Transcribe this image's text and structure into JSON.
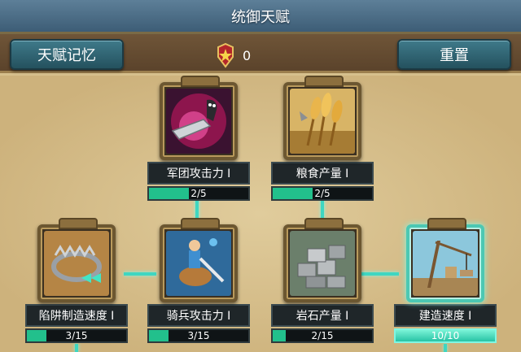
{
  "window": {
    "title": "统御天赋"
  },
  "header": {
    "memory_button": "天赋记忆",
    "reset_button": "重置",
    "points": "0"
  },
  "talents": [
    {
      "name": "军团攻击力 I",
      "progress": "2/5",
      "level": 2,
      "max": 5,
      "icon": "blade-icon"
    },
    {
      "name": "粮食产量 I",
      "progress": "2/5",
      "level": 2,
      "max": 5,
      "icon": "wheat-icon"
    },
    {
      "name": "陷阱制造速度 I",
      "progress": "3/15",
      "level": 3,
      "max": 15,
      "icon": "trap-icon"
    },
    {
      "name": "骑兵攻击力 I",
      "progress": "3/15",
      "level": 3,
      "max": 15,
      "icon": "cavalry-icon"
    },
    {
      "name": "岩石产量 I",
      "progress": "2/15",
      "level": 2,
      "max": 15,
      "icon": "stone-icon"
    },
    {
      "name": "建造速度 I",
      "progress": "10/10",
      "level": 10,
      "max": 10,
      "icon": "crane-icon"
    }
  ],
  "colors": {
    "accent": "#3fd6c1",
    "progress": "#22c08c"
  }
}
